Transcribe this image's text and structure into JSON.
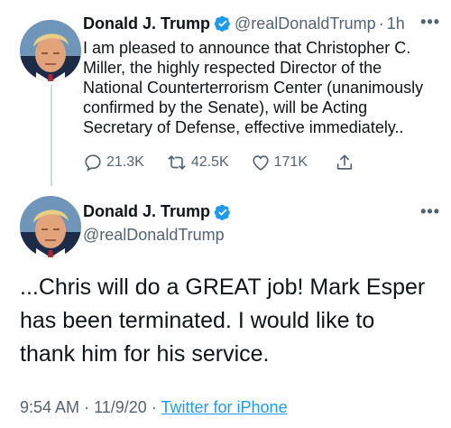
{
  "thread": [
    {
      "author": {
        "name": "Donald J. Trump",
        "handle": "@realDonaldTrump",
        "verified_icon": "verified-badge-icon",
        "avatar_icon": "profile-photo"
      },
      "time": "1h",
      "separator": "·",
      "more_label": "•••",
      "text_lines": [
        "I am pleased to announce that Christopher C.",
        "Miller, the highly respected Director of the",
        "National Counterterrorism Center (unanimously",
        "confirmed by the Senate), will be Acting",
        "Secretary of Defense, effective immediately.."
      ],
      "actions": {
        "reply": {
          "icon": "reply-icon",
          "count": "21.3K"
        },
        "retweet": {
          "icon": "retweet-icon",
          "count": "42.5K"
        },
        "like": {
          "icon": "heart-icon",
          "count": "171K"
        },
        "share": {
          "icon": "share-icon"
        }
      }
    },
    {
      "author": {
        "name": "Donald J. Trump",
        "handle": "@realDonaldTrump",
        "verified_icon": "verified-badge-icon",
        "avatar_icon": "profile-photo"
      },
      "more_label": "•••",
      "text_lines": [
        "...Chris will do a GREAT job! Mark Esper",
        "has been terminated. I would like to",
        "thank him for his service."
      ],
      "meta": {
        "time": "9:54 AM",
        "separator": "·",
        "date": "11/9/20",
        "source": "Twitter for iPhone"
      }
    }
  ],
  "colors": {
    "text": "#0f1419",
    "secondary": "#536471",
    "link": "#1d9bf0",
    "verified": "#1d9bf0",
    "thread_line": "#cfd9de"
  }
}
